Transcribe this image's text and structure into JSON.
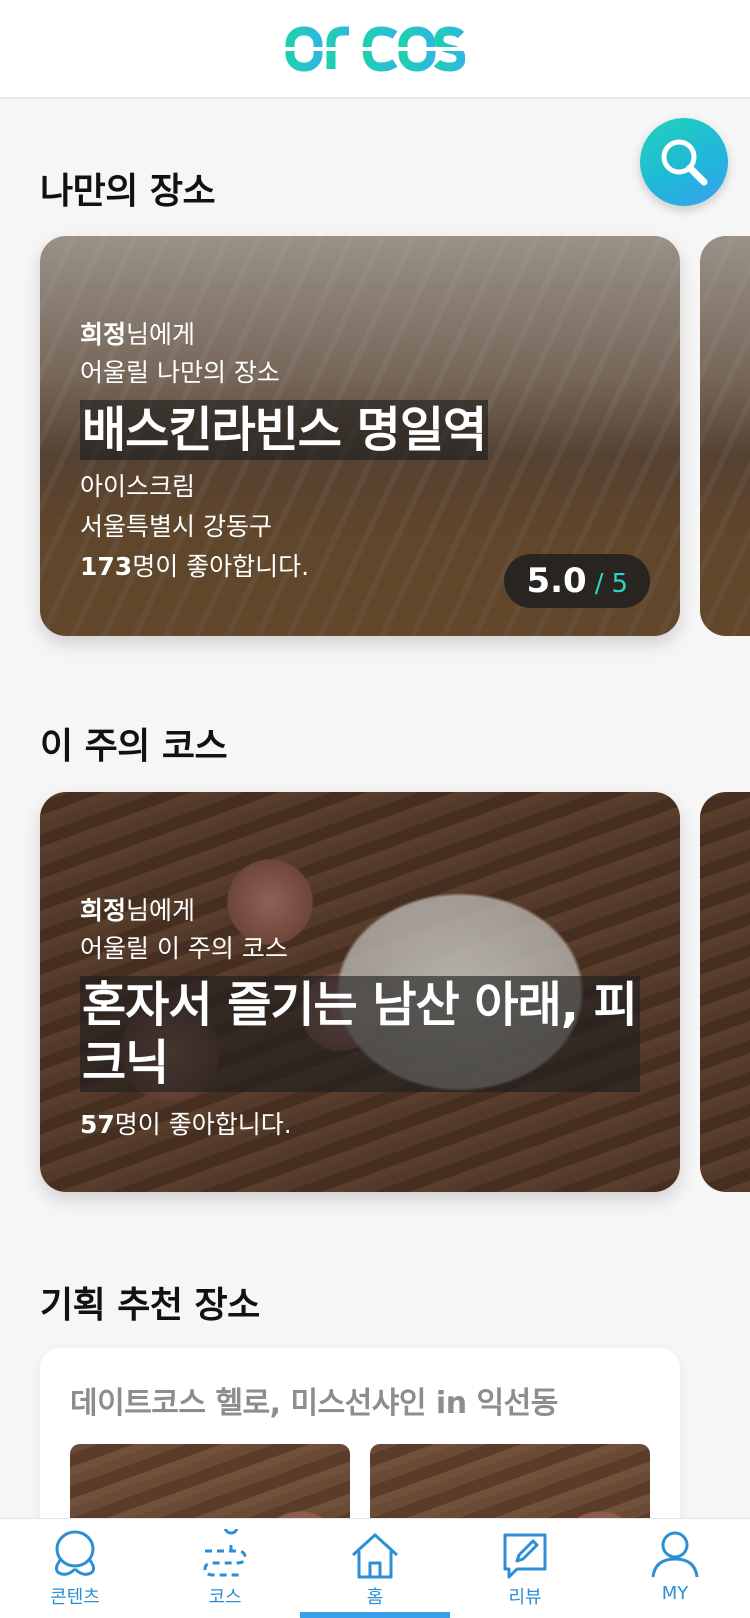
{
  "header": {
    "logo_text": "OF COS"
  },
  "search": {
    "icon": "search-icon"
  },
  "sections": {
    "my_place": "나만의 장소",
    "weekly_course": "이 주의 코스",
    "curated_place": "기획 추천 장소"
  },
  "place_card": {
    "user_name": "희정",
    "greeting_suffix": "님에게",
    "subtitle": "어울릴 나만의 장소",
    "title": "배스킨라빈스 명일역",
    "category": "아이스크림",
    "address": "서울특별시 강동구",
    "like_count": "173",
    "like_suffix": "명이 좋아합니다.",
    "rating_score": "5.0",
    "rating_sep": "/",
    "rating_max": "5"
  },
  "course_card": {
    "user_name": "희정",
    "greeting_suffix": "님에게",
    "subtitle": "어울릴 이 주의 코스",
    "title_line1": "혼자서 즐기는 남산 아래, 피",
    "title_line2": "크닉",
    "like_count": "57",
    "like_suffix": "명이 좋아합니다."
  },
  "curated": {
    "title": "데이트코스 헬로, 미스선샤인 in 익선동"
  },
  "bottom_nav": {
    "items": [
      {
        "label": "콘텐츠",
        "icon": "contents-icon"
      },
      {
        "label": "코스",
        "icon": "course-route-icon"
      },
      {
        "label": "홈",
        "icon": "home-icon",
        "active": true
      },
      {
        "label": "리뷰",
        "icon": "review-edit-icon"
      },
      {
        "label": "MY",
        "icon": "user-icon"
      }
    ]
  },
  "colors": {
    "accent_teal": "#22c7c0",
    "nav_blue": "#2c8fd6",
    "background": "#f6f6f7"
  }
}
